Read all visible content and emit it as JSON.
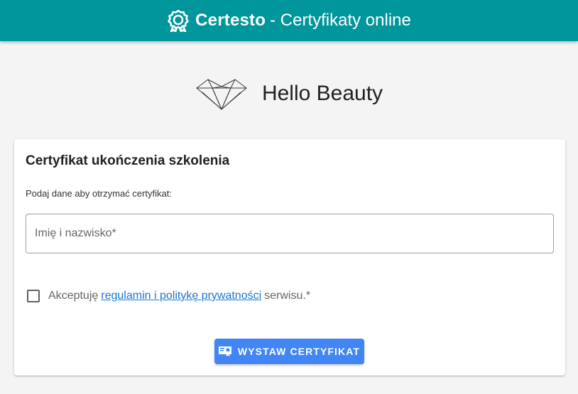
{
  "header": {
    "brand": "Certesto",
    "tagline": "- Certyfikaty online",
    "logo_icon": "award-ribbon-icon",
    "background_color": "#00969b"
  },
  "company": {
    "name": "Hello Beauty",
    "logo_icon": "diamond-outline-icon"
  },
  "card": {
    "title": "Certyfikat ukończenia szkolenia",
    "subtitle": "Podaj dane aby otrzymać certyfikat:",
    "name_field": {
      "placeholder": "Imię i nazwisko*",
      "value": ""
    },
    "consent": {
      "checked": false,
      "prefix": "Akceptuję",
      "link_text": "regulamin i politykę prywatności",
      "suffix": "serwisu.*"
    },
    "submit": {
      "label": "WYSTAW CERTYFIKAT",
      "icon": "certificate-icon",
      "color": "#4285f4"
    }
  }
}
